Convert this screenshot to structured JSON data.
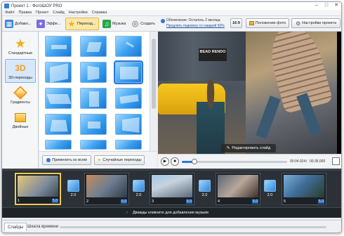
{
  "window": {
    "title": "Проект 1 - ФотоШОУ PRO",
    "minimize": "–",
    "maximize": "□",
    "close": "✕"
  },
  "menu": [
    "Файл",
    "Правка",
    "Проект",
    "Слайд",
    "Настройки",
    "Справка"
  ],
  "toolbar": {
    "tabs": [
      {
        "label": "Добавл...",
        "icon": "add-photo-icon",
        "glyph": "▦",
        "color": "#3a86d9"
      },
      {
        "label": "Эффе...",
        "icon": "effects-icon",
        "glyph": "✦",
        "color": "#7b6ce0"
      },
      {
        "label": "Переход...",
        "icon": "star-icon",
        "glyph": "★",
        "color": "#f2b01e",
        "active": true
      },
      {
        "label": "Музыка",
        "icon": "music-icon",
        "glyph": "♫",
        "color": "#28a745"
      },
      {
        "label": "Создать",
        "icon": "film-reel-icon",
        "glyph": "◎",
        "color": "#555"
      }
    ]
  },
  "info": {
    "update_text": "Обновление: Осталось 2 месяца",
    "renew_link": "Продлить подписку со скидкой 50%"
  },
  "buttons": {
    "aspect": "16:9",
    "photo_position": "Положение фото",
    "project_settings": "Настройки проекта"
  },
  "transition_categories": [
    {
      "label": "Стандартные",
      "icon": "star-icon"
    },
    {
      "label": "3D-переходы",
      "icon": "3d-icon",
      "active": true
    },
    {
      "label": "Градиенты",
      "icon": "gradient-icon"
    },
    {
      "label": "Двойные",
      "icon": "double-icon"
    }
  ],
  "gallery_buttons": {
    "apply_all": "Применить ко всем",
    "random": "Случайные переходы"
  },
  "preview": {
    "edit_label": "Редактировать слайд",
    "time_current": "00:04.024",
    "time_total": "00:35.000",
    "progress": 0.12,
    "sign_text": "BEAD RENDO"
  },
  "slides": [
    {
      "num": "1",
      "duration": "5.0",
      "trans": "2.0"
    },
    {
      "num": "2",
      "duration": "5.0",
      "trans": "2.0"
    },
    {
      "num": "3",
      "duration": "5.0",
      "trans": "2.0"
    },
    {
      "num": "4",
      "duration": "5.0",
      "trans": "2.0"
    },
    {
      "num": "5",
      "duration": "5.0",
      "trans": ""
    }
  ],
  "music_hint": "Дважды кликните для добавления музыки",
  "bottom_tabs": {
    "slides": "Слайды",
    "timeline": "Шкала времени"
  },
  "colors": {
    "accent": "#2f77d8",
    "selection": "#f2c94c",
    "timeline_bg": "#2b3137"
  }
}
